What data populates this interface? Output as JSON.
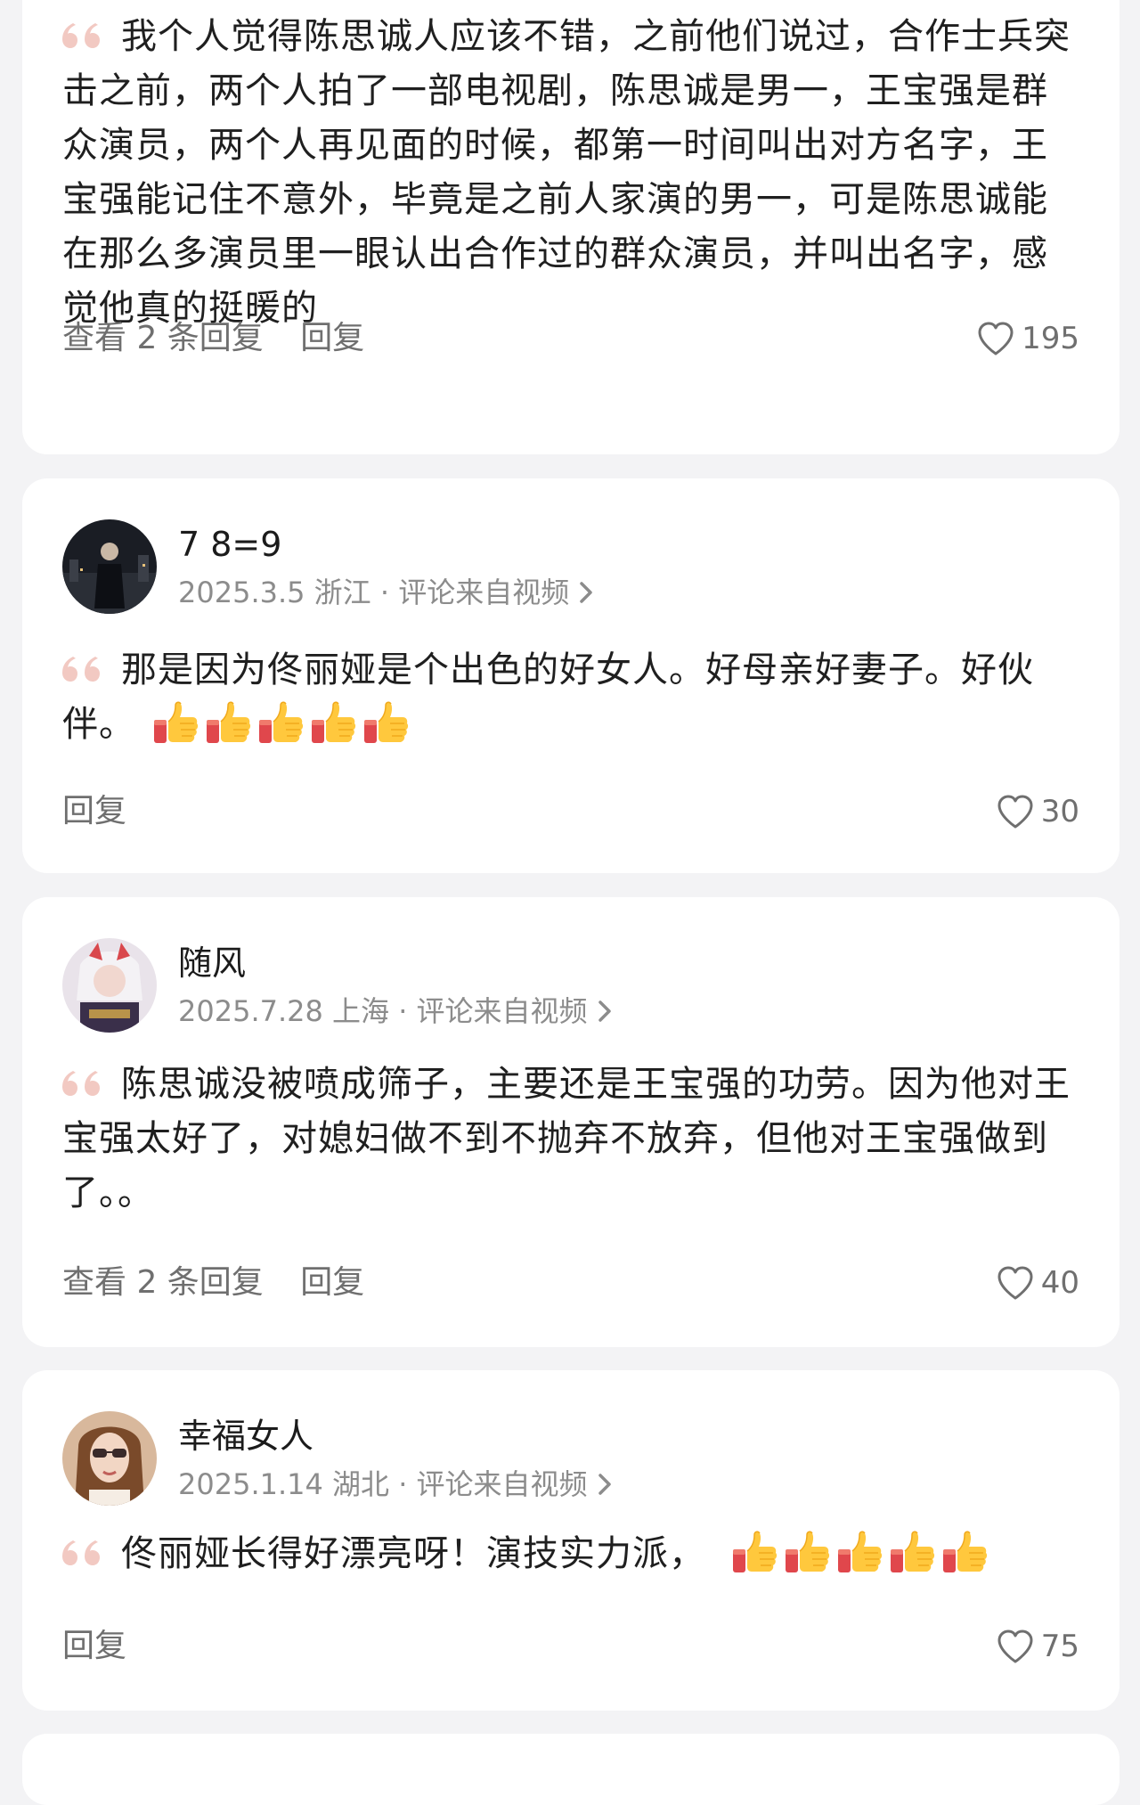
{
  "comments": [
    {
      "text": "我个人觉得陈思诚人应该不错，之前他们说过，合作士兵突击之前，两个人拍了一部电视剧，陈思诚是男一，王宝强是群众演员，两个人再见面的时候，都第一时间叫出对方名字，王宝强能记住不意外，毕竟是之前人家演的男一，可是陈思诚能在那么多演员里一眼认出合作过的群众演员，并叫出名字，感觉他真的挺暖的",
      "view_replies": "查看 2 条回复",
      "reply": "回复",
      "likes": "195"
    },
    {
      "username": "7 8=9",
      "meta": "2025.3.5 浙江 · 评论来自视频",
      "text": "那是因为佟丽娅是个出色的好女人。好母亲好妻子。好伙伴。",
      "emoji": "thumbs-up-icon",
      "emoji_count": 5,
      "reply": "回复",
      "likes": "30"
    },
    {
      "username": "随风",
      "meta": "2025.7.28 上海 · 评论来自视频",
      "text": "陈思诚没被喷成筛子，主要还是王宝强的功劳。因为他对王宝强太好了，对媳妇做不到不抛弃不放弃，但他对王宝强做到了。。",
      "view_replies": "查看 2 条回复",
      "reply": "回复",
      "likes": "40"
    },
    {
      "username": "幸福女人",
      "meta": "2025.1.14 湖北 · 评论来自视频",
      "text": "佟丽娅长得好漂亮呀！演技实力派，",
      "emoji": "thumbs-up-icon",
      "emoji_count": 5,
      "reply": "回复",
      "likes": "75"
    }
  ],
  "colors": {
    "background": "#f3f3f5",
    "card": "#ffffff",
    "quote_mark": "#f2c9c2",
    "secondary_text": "#8c8c8c"
  }
}
